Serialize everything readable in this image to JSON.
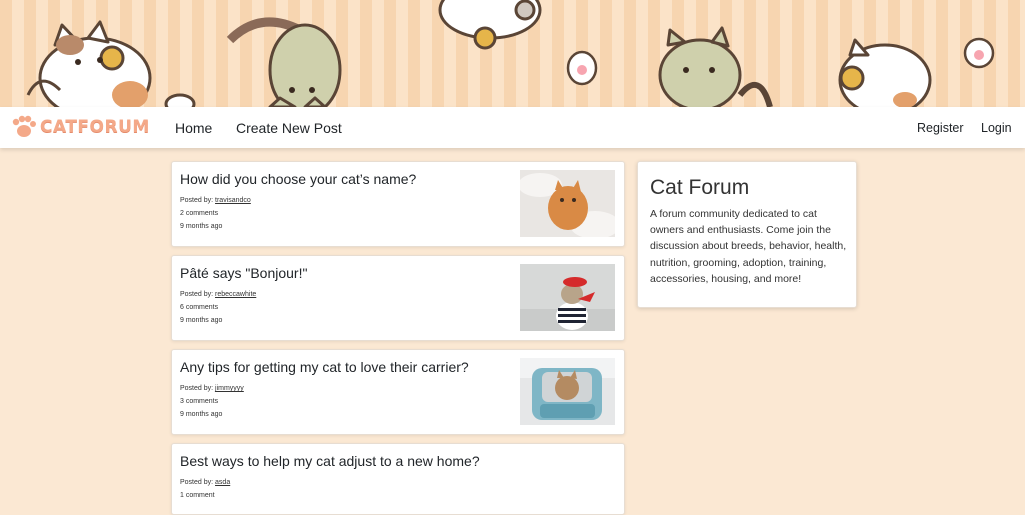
{
  "header": {
    "logo_text": "CATFORUM",
    "nav": {
      "home": "Home",
      "create": "Create New Post",
      "register": "Register",
      "login": "Login"
    }
  },
  "posts": [
    {
      "title": "How did you choose your cat’s name?",
      "posted_by_label": "Posted by: ",
      "author": "travisandco",
      "comments": "2 comments",
      "time": "9 months ago",
      "thumb": "ginger-cat-on-fluffy-blanket"
    },
    {
      "title": "Pâté says \"Bonjour!\"",
      "posted_by_label": "Posted by: ",
      "author": "rebeccawhite",
      "comments": "6 comments",
      "time": "9 months ago",
      "thumb": "cat-in-beret-and-striped-shirt"
    },
    {
      "title": "Any tips for getting my cat to love their carrier?",
      "posted_by_label": "Posted by: ",
      "author": "jimmyyyy",
      "comments": "3 comments",
      "time": "9 months ago",
      "thumb": "cat-in-pet-carrier"
    },
    {
      "title": "Best ways to help my cat adjust to a new home?",
      "posted_by_label": "Posted by: ",
      "author": "asda",
      "comments": "1 comment",
      "time": ""
    }
  ],
  "sidebar": {
    "title": "Cat Forum",
    "description": "A forum community dedicated to cat owners and enthusiasts. Come join the discussion about breeds, behavior, health, nutrition, grooming, adoption, training, accessories, housing, and more!"
  },
  "colors": {
    "page_bg": "#fbe8d3",
    "stripe_dark": "#f7d5b0",
    "stripe_light": "#fbe3c8",
    "logo": "#f4a989"
  }
}
